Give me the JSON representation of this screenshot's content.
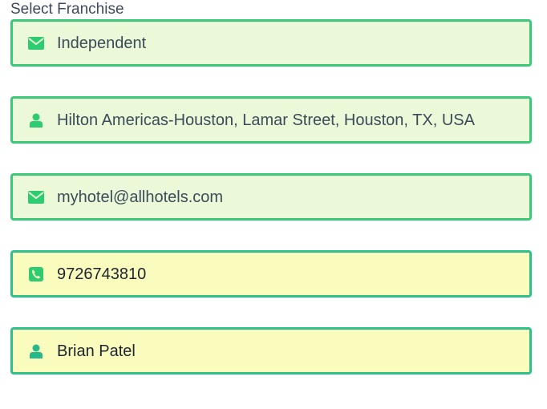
{
  "form": {
    "label": "Select Franchise",
    "fields": [
      {
        "icon": "envelope-icon",
        "value": "Independent"
      },
      {
        "icon": "user-icon",
        "value": "Hilton Americas-Houston, Lamar Street, Houston, TX, USA"
      },
      {
        "icon": "envelope-icon",
        "value": "myhotel@allhotels.com"
      },
      {
        "icon": "phone-icon",
        "value": "9726743810"
      },
      {
        "icon": "user-icon",
        "value": "Brian Patel"
      }
    ]
  },
  "colors": {
    "border": "#3cc87a",
    "icon": "#2ecc71",
    "filled_bg": "#ebf9d8",
    "highlight_bg": "#f9fcbd"
  }
}
